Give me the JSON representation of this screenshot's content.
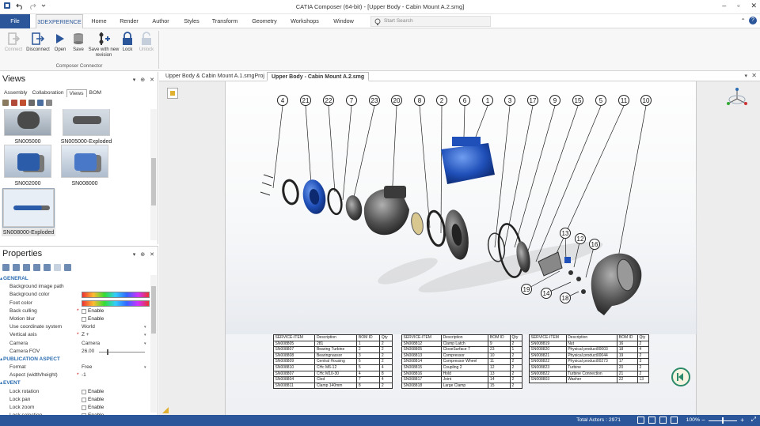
{
  "window": {
    "title": "CATIA Composer (64-bit) - [Upper Body - Cabin Mount A.2.smg]",
    "controls": [
      "–",
      "▫",
      "✕"
    ]
  },
  "menu": {
    "file": "File",
    "tabs": [
      "3DEXPERIENCE",
      "Home",
      "Render",
      "Author",
      "Styles",
      "Transform",
      "Geometry",
      "Workshops",
      "Window"
    ],
    "search_placeholder": "Start Search"
  },
  "ribbon": {
    "buttons": [
      {
        "label": "Connect",
        "enabled": false,
        "icon": "connect-icon"
      },
      {
        "label": "Disconnect",
        "enabled": true,
        "icon": "disconnect-icon"
      },
      {
        "label": "Open",
        "enabled": true,
        "icon": "open-icon"
      },
      {
        "label": "Save",
        "enabled": true,
        "icon": "save-icon"
      },
      {
        "label": "Save with new revision",
        "enabled": true,
        "icon": "save-revision-icon"
      },
      {
        "label": "Lock",
        "enabled": true,
        "icon": "lock-icon"
      },
      {
        "label": "Unlock",
        "enabled": false,
        "icon": "unlock-icon"
      }
    ],
    "group_label": "Composer Connector"
  },
  "views_panel": {
    "title": "Views",
    "controls": [
      "▾",
      "⊕",
      "✕"
    ],
    "tabs": [
      "Assembly",
      "Collaboration",
      "Views",
      "BOM"
    ],
    "active_tab": "Views",
    "thumbnails": [
      {
        "label": "SN005000",
        "selected": false
      },
      {
        "label": "SN005000-Exploded",
        "selected": false
      },
      {
        "label": "SN002000",
        "selected": false
      },
      {
        "label": "SN008000",
        "selected": false
      },
      {
        "label": "SN008000-Exploded",
        "selected": true
      }
    ]
  },
  "properties_panel": {
    "title": "Properties",
    "controls": [
      "▾",
      "⊕",
      "✕"
    ],
    "rows": [
      {
        "type": "section",
        "key": "GENERAL"
      },
      {
        "type": "text",
        "key": "Background image path",
        "value": ""
      },
      {
        "type": "gradient",
        "key": "Background color"
      },
      {
        "type": "gradient",
        "key": "Foot color"
      },
      {
        "type": "check",
        "key": "Back culling",
        "value": "Enable",
        "star": true
      },
      {
        "type": "check",
        "key": "Motion blur",
        "value": "Enable"
      },
      {
        "type": "select",
        "key": "Use coordinate system",
        "value": "World"
      },
      {
        "type": "select",
        "key": "Vertical axis",
        "value": "Z +",
        "star": true
      },
      {
        "type": "select",
        "key": "Camera",
        "value": "Camera"
      },
      {
        "type": "slider",
        "key": "Camera FOV",
        "value": "26.00"
      },
      {
        "type": "section",
        "key": "PUBLICATION ASPECT"
      },
      {
        "type": "select",
        "key": "Format",
        "value": "Free"
      },
      {
        "type": "text",
        "key": "Aspect (width/height)",
        "value": "-1",
        "star": true
      },
      {
        "type": "section",
        "key": "EVENT"
      },
      {
        "type": "check",
        "key": "Lock rotation",
        "value": "Enable"
      },
      {
        "type": "check",
        "key": "Lock pan",
        "value": "Enable"
      },
      {
        "type": "check",
        "key": "Lock zoom",
        "value": "Enable"
      },
      {
        "type": "check",
        "key": "Lock selection",
        "value": "Enable"
      }
    ]
  },
  "document_tabs": [
    {
      "label": "Upper Body & Cabin Mount A.1.smgProj",
      "active": false
    },
    {
      "label": "Upper Body - Cabin Mount A.2.smg",
      "active": true
    }
  ],
  "balloons": [
    "4",
    "21",
    "22",
    "7",
    "23",
    "20",
    "8",
    "2",
    "6",
    "1",
    "3",
    "17",
    "9",
    "15",
    "5",
    "11",
    "10",
    "13",
    "12",
    "16",
    "19",
    "14",
    "18"
  ],
  "bom_headers": [
    "SERVICE-ITEM",
    "Description",
    "BOM ID",
    "Qty"
  ],
  "bom_tables": [
    [
      [
        "SN008805",
        "281",
        "1",
        "2"
      ],
      [
        "SN008807",
        "Bearing Turbine",
        "2",
        "2"
      ],
      [
        "SN008808",
        "Bearingnassor",
        "3",
        "2"
      ],
      [
        "SN008809",
        "Central Housing",
        "6",
        "2"
      ],
      [
        "SN008810",
        "CHc M6-12",
        "5",
        "4"
      ],
      [
        "SN008807",
        "CHc M10-30",
        "4",
        "8"
      ],
      [
        "SN008804",
        "Clod",
        "7",
        "4"
      ],
      [
        "SN008811",
        "Clamp 140mm",
        "8",
        "2"
      ]
    ],
    [
      [
        "SN008812",
        "Clamp Latch",
        "9",
        "2"
      ],
      [
        "SN008805",
        "CloseSurface 7",
        "23",
        "1"
      ],
      [
        "SN008813",
        "Compressor",
        "10",
        "2"
      ],
      [
        "SN008814",
        "Compressor Wheel",
        "11",
        "2"
      ],
      [
        "SN008815",
        "Coupling 2",
        "12",
        "2"
      ],
      [
        "SN008816",
        "Hold",
        "13",
        "2"
      ],
      [
        "SN008817",
        "Joint",
        "14",
        "2"
      ],
      [
        "SN008818",
        "Large Clamp",
        "15",
        "2"
      ]
    ],
    [
      [
        "SN008819",
        "Nut",
        "16",
        "2"
      ],
      [
        "SN008820",
        "Physical product00003",
        "18",
        "4"
      ],
      [
        "SN008821",
        "Physical product00044",
        "19",
        "2"
      ],
      [
        "SN008822",
        "Physical product00273",
        "17",
        "3"
      ],
      [
        "SN008823",
        "Turbine",
        "20",
        "2"
      ],
      [
        "SN008822",
        "Turbine Connection",
        "21",
        "2"
      ],
      [
        "SN008803",
        "Washer",
        "22",
        "13"
      ]
    ]
  ],
  "status": {
    "actors": "Total Actors : 2971",
    "zoom": "100%"
  },
  "colors": {
    "accent": "#2b579a",
    "part_blue": "#1f4fb8",
    "part_gray": "#5a5a5a"
  }
}
